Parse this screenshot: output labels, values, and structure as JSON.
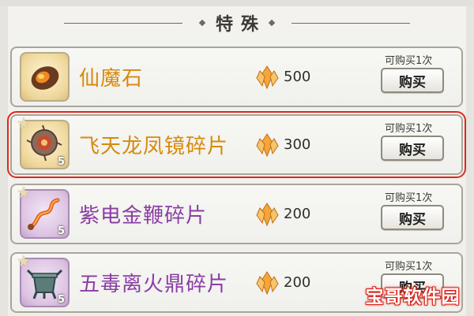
{
  "section": {
    "title": "特殊"
  },
  "items": [
    {
      "name": "仙魔石",
      "price": "500",
      "limit": "可购买1次",
      "buy_label": "购买",
      "fragment_count": "",
      "icon": "gem-stone-icon",
      "rarity": "gold",
      "selected": false
    },
    {
      "name": "飞天龙凤镜碎片",
      "price": "300",
      "limit": "可购买1次",
      "buy_label": "购买",
      "fragment_count": "5",
      "icon": "mirror-fragment-icon",
      "rarity": "gold",
      "selected": true
    },
    {
      "name": "紫电金鞭碎片",
      "price": "200",
      "limit": "可购买1次",
      "buy_label": "购买",
      "fragment_count": "5",
      "icon": "whip-fragment-icon",
      "rarity": "purple",
      "selected": false
    },
    {
      "name": "五毒离火鼎碎片",
      "price": "200",
      "limit": "可购买1次",
      "buy_label": "购买",
      "fragment_count": "5",
      "icon": "cauldron-fragment-icon",
      "rarity": "purple",
      "selected": false
    }
  ],
  "currency": {
    "icon": "crystal-currency-icon"
  },
  "watermark": {
    "text": "宝哥软件园"
  },
  "colors": {
    "gold_name": "#d68a0c",
    "purple_name": "#8a3ea5",
    "selection": "#e0261e"
  }
}
